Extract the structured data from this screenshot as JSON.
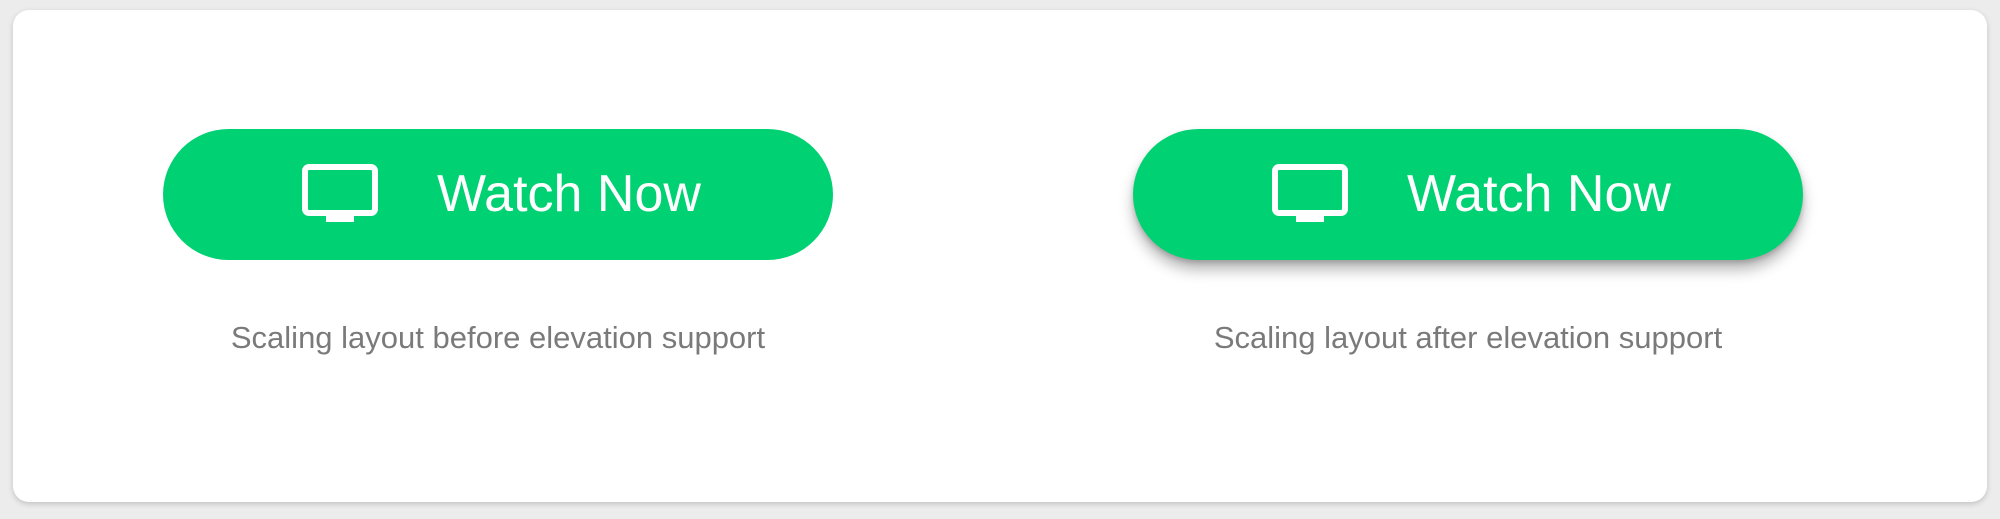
{
  "colors": {
    "button_bg": "#00d273",
    "button_text": "#ffffff",
    "caption_text": "#7a7a7a",
    "card_bg": "#ffffff"
  },
  "examples": [
    {
      "button": {
        "label": "Watch Now",
        "icon": "tv-monitor-icon",
        "elevated": false
      },
      "caption": "Scaling layout before elevation support"
    },
    {
      "button": {
        "label": "Watch Now",
        "icon": "tv-monitor-icon",
        "elevated": true
      },
      "caption": "Scaling layout after elevation support"
    }
  ]
}
